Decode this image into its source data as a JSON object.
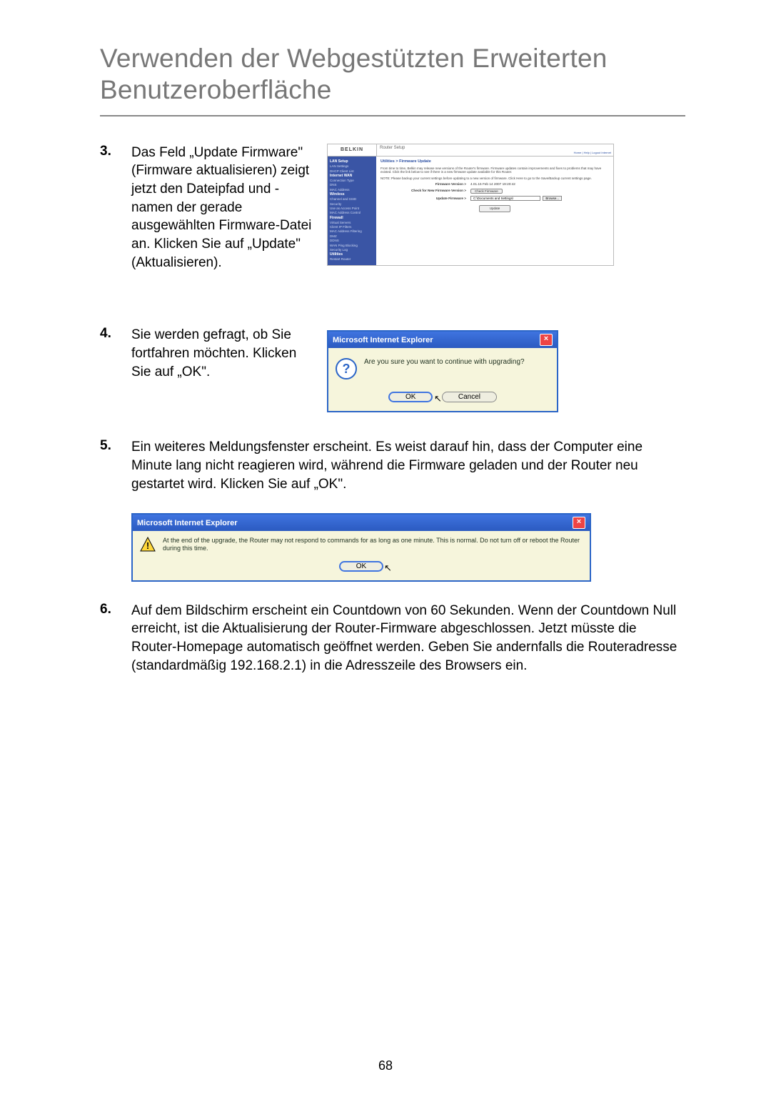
{
  "page_number": "68",
  "heading": "Verwenden der Webgestützten Erweiterten Benutzeroberfläche",
  "steps": {
    "s3": {
      "num": "3.",
      "text": "Das Feld „Update Firmware\" (Firmware aktualisieren) zeigt jetzt den Dateipfad und -namen der gerade ausgewählten Firmware-Datei an. Klicken Sie auf „Update\" (Aktualisieren)."
    },
    "s4": {
      "num": "4.",
      "text": "Sie werden gefragt, ob Sie fortfahren möchten. Klicken Sie auf „OK\"."
    },
    "s5": {
      "num": "5.",
      "text": "Ein weiteres Meldungsfenster erscheint. Es weist darauf hin, dass der Computer eine Minute lang nicht reagieren wird, während die Firmware geladen und der Router neu gestartet wird. Klicken Sie auf „OK\"."
    },
    "s6": {
      "num": "6.",
      "text": "Auf dem Bildschirm erscheint ein Countdown von 60 Sekunden. Wenn der Countdown Null erreicht, ist die Aktualisierung der Router-Firmware abgeschlossen. Jetzt müsste die Router-Homepage automatisch geöffnet werden. Geben Sie andernfalls die Routeradresse (standardmäßig 192.168.2.1) in die Adresszeile des Browsers ein."
    }
  },
  "router": {
    "logo": "BELKIN",
    "title": "Router Setup",
    "top_links": "Home | Help | Logout   Internet",
    "nav": [
      {
        "type": "grp",
        "label": "LAN Setup"
      },
      {
        "type": "itm",
        "label": "LAN Settings"
      },
      {
        "type": "itm",
        "label": "DHCP Client List"
      },
      {
        "type": "grp",
        "label": "Internet WAN"
      },
      {
        "type": "itm",
        "label": "Connection Type"
      },
      {
        "type": "itm",
        "label": "DNS"
      },
      {
        "type": "itm",
        "label": "MAC Address"
      },
      {
        "type": "grp",
        "label": "Wireless"
      },
      {
        "type": "itm",
        "label": "Channel and SSID"
      },
      {
        "type": "itm",
        "label": "Security"
      },
      {
        "type": "itm",
        "label": "Use as Access Point"
      },
      {
        "type": "itm",
        "label": "MAC Address Control"
      },
      {
        "type": "grp",
        "label": "Firewall"
      },
      {
        "type": "itm",
        "label": "Virtual Servers"
      },
      {
        "type": "itm",
        "label": "Client IP Filters"
      },
      {
        "type": "itm",
        "label": "MAC Address Filtering"
      },
      {
        "type": "itm",
        "label": "DMZ"
      },
      {
        "type": "itm",
        "label": "DDNS"
      },
      {
        "type": "itm",
        "label": "WAN Ping Blocking"
      },
      {
        "type": "itm",
        "label": "Security Log"
      },
      {
        "type": "grp",
        "label": "Utilities"
      },
      {
        "type": "itm",
        "label": "Restart Router"
      }
    ],
    "breadcrumb": "Utilities > Firmware Update",
    "p1": "From time to time, Belkin may release new versions of the Router's firmware. Firmware updates contain improvements and fixes to problems that may have existed. Click the link below to see if there is a new firmware update available for this Router.",
    "p2": "NOTE: Please backup your current settings before updating to a new version of firmware. Click Here to go to the Save/Backup current settings page.",
    "row_fw_label": "Firmware Version >",
    "row_fw_value": "4.01.15 Feb 14 2007 19:20:42",
    "row_check_label": "Check for New Firmware Version >",
    "row_check_btn": "Check Firmware",
    "row_upd_label": "Update Firmware >",
    "row_upd_value": "C:\\Documents and Settings\\",
    "row_upd_browse": "Browse...",
    "update_btn": "Update"
  },
  "dialog1": {
    "title": "Microsoft Internet Explorer",
    "message": "Are you sure you want to continue with upgrading?",
    "ok": "OK",
    "cancel": "Cancel"
  },
  "dialog2": {
    "title": "Microsoft Internet Explorer",
    "message": "At the end of the upgrade, the Router may not respond to commands for as long as one minute. This is normal. Do not turn off or reboot the Router during this time.",
    "ok": "OK"
  }
}
